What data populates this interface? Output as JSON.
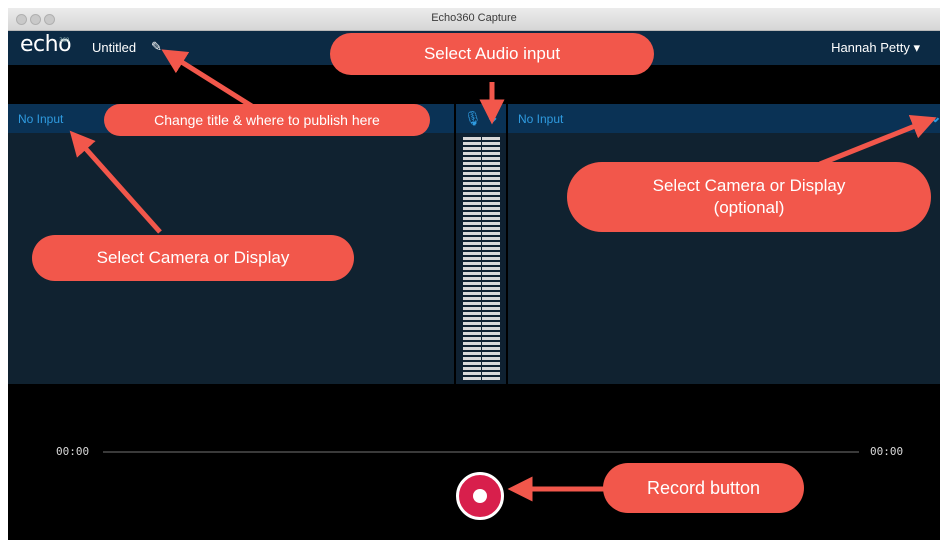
{
  "window": {
    "title": "Echo360 Capture"
  },
  "app": {
    "logo": "echo",
    "logo_mark": "360",
    "doc_title": "Untitled",
    "user_name": "Hannah Petty",
    "user_caret": "▾"
  },
  "panels": {
    "left": {
      "label": "No Input"
    },
    "right": {
      "label": "No Input"
    }
  },
  "playback": {
    "time_start": "00:00",
    "time_end": "00:00"
  },
  "annotations": {
    "title_hint": "Change title & where to publish here",
    "audio_hint": "Select Audio input",
    "camera_hint": "Select Camera or Display",
    "camera_optional_line1": "Select Camera or Display",
    "camera_optional_line2": "(optional)",
    "record_hint": "Record button"
  },
  "colors": {
    "app_bar": "#0c2a44",
    "accent": "#2f9be0",
    "record": "#d81f4c",
    "callout": "#f2574b"
  },
  "icons": [
    "pencil-icon",
    "microphone-icon",
    "chevron-down-icon",
    "record-icon"
  ]
}
